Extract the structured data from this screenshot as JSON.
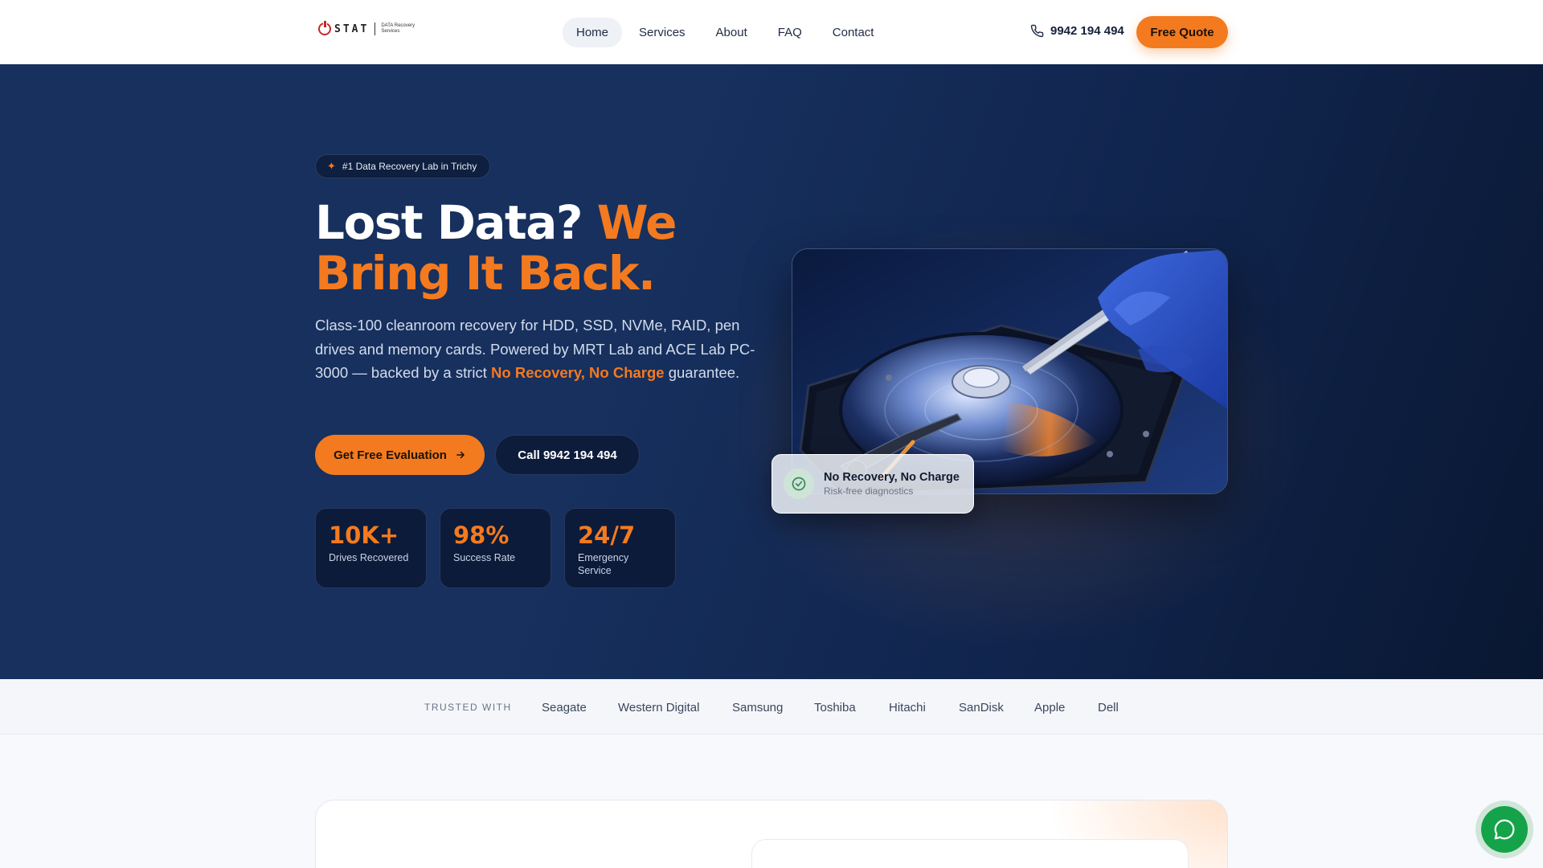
{
  "header": {
    "logo": {
      "word": "STAT",
      "sub": "DATA Recovery Services"
    },
    "nav": [
      {
        "label": "Home",
        "active": true
      },
      {
        "label": "Services"
      },
      {
        "label": "About"
      },
      {
        "label": "FAQ"
      },
      {
        "label": "Contact"
      }
    ],
    "phone": "9942 194 494",
    "quote_label": "Free Quote"
  },
  "hero": {
    "badge": "#1 Data Recovery Lab in Trichy",
    "headline_white": "Lost Data?",
    "headline_accent_1": "We",
    "headline_accent_2": "Bring It Back.",
    "lede_part1": "Class-100 cleanroom recovery for HDD, SSD, NVMe, RAID, pen drives and memory cards. Powered by MRT Lab and ACE Lab PC-3000 — backed by a strict",
    "lede_highlight": "No Recovery, No Charge",
    "lede_part2": "guarantee.",
    "cta_primary": "Get Free Evaluation",
    "cta_secondary": "Call 9942 194 494",
    "stats": [
      {
        "value": "10K+",
        "label": "Drives Recovered"
      },
      {
        "value": "98%",
        "label": "Success Rate"
      },
      {
        "value": "24/7",
        "label": "Emergency Service"
      }
    ],
    "float_title": "No Recovery, No Charge",
    "float_sub": "Risk-free diagnostics"
  },
  "trusted": {
    "label": "TRUSTED WITH",
    "brands": [
      "Seagate",
      "Western Digital",
      "Samsung",
      "Toshiba",
      "Hitachi",
      "SanDisk",
      "Apple",
      "Dell"
    ]
  },
  "colors": {
    "accent": "#f47a1f",
    "hero_bg": "#17305e",
    "whatsapp": "#15a34a"
  },
  "icons": {
    "phone": "phone-icon",
    "badge": "sparkle-icon",
    "arrow": "arrow-right-icon",
    "check": "check-circle-icon",
    "chat": "chat-bubble-icon"
  }
}
